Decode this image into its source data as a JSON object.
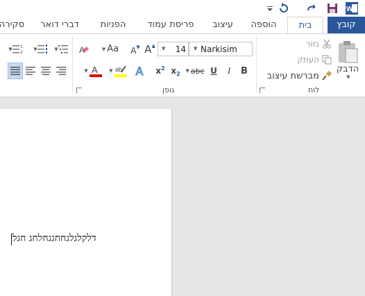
{
  "colors": {
    "accent": "#2b579a",
    "font_color_bar": "#e00000",
    "highlight_bar": "#ffff00"
  },
  "tabs": {
    "file": "קובץ",
    "home": "בית",
    "insert": "הוספה",
    "design": "עיצוב",
    "layout": "פריסת עמוד",
    "references": "הפניות",
    "mailings": "דברי דואר",
    "review": "סקירה"
  },
  "ribbon": {
    "clipboard": {
      "paste_label": "הדבק",
      "cut_label": "גזור",
      "copy_label": "העתק",
      "format_painter_label": "מברשת עיצוב",
      "group_label": "לוח"
    },
    "font": {
      "font_name": "Narkisim",
      "font_size": "14",
      "group_label": "גופן",
      "change_case": "Aa",
      "grow_font": "A",
      "shrink_font": "A",
      "bold": "B",
      "italic": "I",
      "underline": "U",
      "strikethrough": "abc",
      "subscript": "x",
      "superscript": "x",
      "text_effects": "A",
      "font_color": "A"
    }
  },
  "document": {
    "text": "דלקלגלגחחגגחלחג חגל"
  }
}
